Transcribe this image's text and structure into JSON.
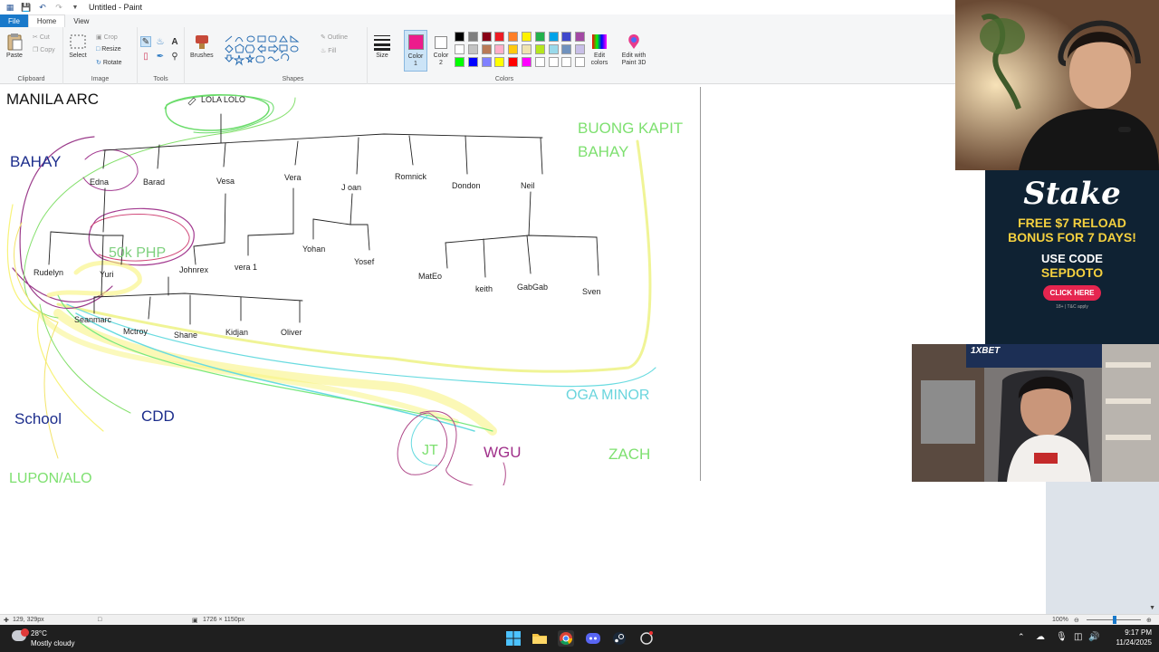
{
  "window": {
    "title": "Untitled - Paint"
  },
  "menu": {
    "tabs": [
      "File",
      "Home",
      "View"
    ]
  },
  "ribbon": {
    "clipboard": {
      "paste": "Paste",
      "cut": "Cut",
      "copy": "Copy",
      "label": "Clipboard"
    },
    "image": {
      "select": "Select",
      "crop": "Crop",
      "resize": "Resize",
      "rotate": "Rotate",
      "label": "Image"
    },
    "tools": {
      "label": "Tools"
    },
    "brushes": {
      "label": "Brushes"
    },
    "shapes": {
      "outline": "Outline",
      "fill": "Fill",
      "label": "Shapes"
    },
    "size": {
      "label": "Size"
    },
    "colors": {
      "color1": "Color 1",
      "color2": "Color 2",
      "edit": "Edit colors",
      "paint3d": "Edit with Paint 3D",
      "label": "Colors",
      "color1_value": "#ec1c8c",
      "color2_value": "#ffffff",
      "palette": [
        "#000000",
        "#7f7f7f",
        "#880015",
        "#ed1c24",
        "#ff7f27",
        "#fff200",
        "#22b14c",
        "#00a2e8",
        "#3f48cc",
        "#a349a4",
        "#ffffff",
        "#c3c3c3",
        "#b97a57",
        "#ffaec9",
        "#ffc90e",
        "#efe4b0",
        "#b5e61d",
        "#99d9ea",
        "#7092be",
        "#c8bfe7",
        "#00ff00",
        "#0000ff",
        "#8080ff",
        "#ffff00",
        "#ff0000",
        "#ff00ff",
        "#ffffff",
        "#ffffff",
        "#ffffff",
        "#ffffff"
      ]
    }
  },
  "canvas": {
    "heading": "MANILA ARC",
    "top_node": "LOLA LOLO",
    "labels": {
      "bahay": "BAHAY",
      "buong_kapit": "BUONG KAPIT",
      "buong_kapit_2": "BAHAY",
      "php": "50k PHP",
      "school": "School",
      "cdd": "CDD",
      "lupon": "LUPON/ALO",
      "oga": "OGA MINOR",
      "zach": "ZACH",
      "jt": "JT",
      "wgu": "WGU"
    },
    "children": [
      "Edna",
      "Barad",
      "Vesa",
      "Vera",
      "J oan",
      "Romnick",
      "Dondon",
      "Neil"
    ],
    "grandchildren": [
      "Rudelyn",
      "Yuri",
      "Johnrex",
      "vera 1",
      "Yohan",
      "Yosef",
      "MatEo",
      "keith",
      "GabGab",
      "Sven",
      "Seanmarc",
      "Mctroy",
      "Shane",
      "Kidjan",
      "Oliver"
    ]
  },
  "status": {
    "cursor": "129, 329px",
    "size": "1726 × 1150px",
    "zoom": "100%"
  },
  "taskbar": {
    "temp": "28°C",
    "weather": "Mostly cloudy",
    "time": "9:17 PM",
    "date": "11/24/2025"
  },
  "ad": {
    "brand": "Stake",
    "line1": "FREE $7 RELOAD",
    "line2": "BONUS FOR 7 DAYS!",
    "line3": "USE CODE",
    "code": "SEPDOTO",
    "cta": "CLICK HERE",
    "fine": "18+ | T&C apply"
  },
  "cam2": {
    "sign": "1XBET"
  }
}
